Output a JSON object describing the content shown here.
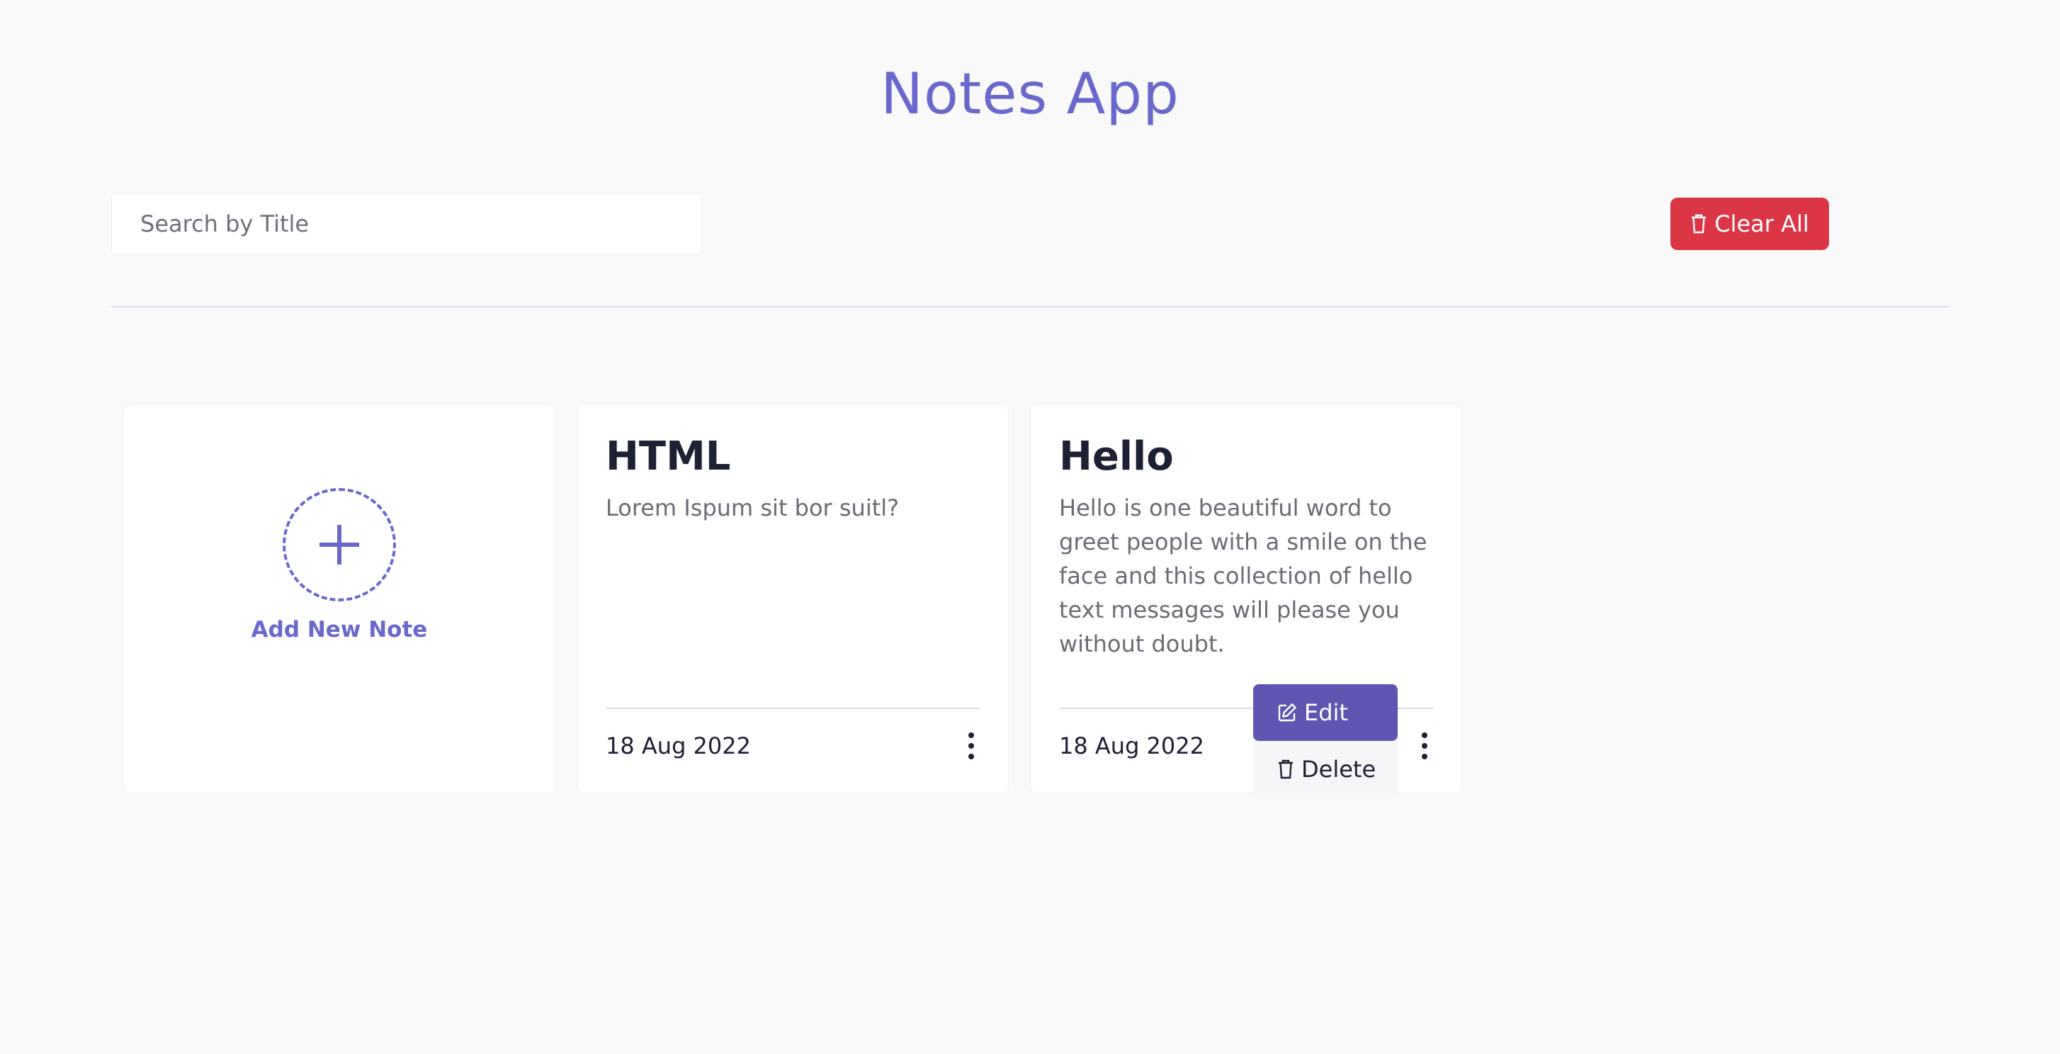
{
  "app": {
    "title": "Notes App"
  },
  "toolbar": {
    "search_placeholder": "Search by Title",
    "search_value": "",
    "clear_all_label": "Clear All"
  },
  "add_note": {
    "label": "Add New Note"
  },
  "notes": [
    {
      "title": "HTML",
      "description": "Lorem Ispum sit bor suitl?",
      "date": "18 Aug 2022"
    },
    {
      "title": "Hello",
      "description": "Hello is one beautiful word to greet people with a smile on the face and this collection of hello text messages will please you without doubt.",
      "date": "18 Aug 2022"
    }
  ],
  "context_menu": {
    "edit_label": "Edit",
    "delete_label": "Delete"
  },
  "colors": {
    "accent": "#6a68cc",
    "danger": "#dc3545",
    "menu_active": "#5f56b2",
    "background": "#f9f9f9"
  },
  "icons": {
    "clear_all": "trash-icon",
    "add": "plus-icon",
    "edit": "edit-icon",
    "delete": "trash-icon",
    "menu": "more-vertical-icon"
  }
}
